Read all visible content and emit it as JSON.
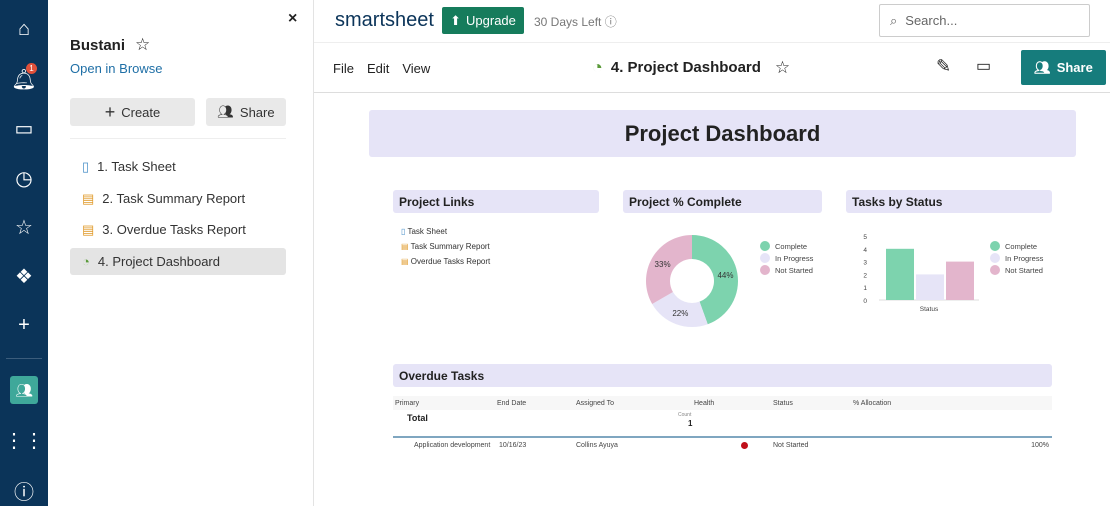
{
  "nav": {
    "notification_count": "1"
  },
  "panel": {
    "workspace": "Bustani",
    "open_in_browse": "Open in Browse",
    "create": "Create",
    "share": "Share",
    "items": [
      {
        "label": "1. Task Sheet",
        "icon": "sheet-icon"
      },
      {
        "label": "2. Task Summary Report",
        "icon": "report-icon"
      },
      {
        "label": "3. Overdue Tasks Report",
        "icon": "report-icon"
      },
      {
        "label": "4. Project Dashboard",
        "icon": "dashboard-icon"
      }
    ]
  },
  "topbar": {
    "logo": "smartsheet",
    "upgrade": "Upgrade",
    "trial": "30 Days Left",
    "search_placeholder": "Search..."
  },
  "toolbar": {
    "menu": [
      "File",
      "Edit",
      "View"
    ],
    "title": "4. Project Dashboard",
    "share": "Share"
  },
  "dashboard": {
    "title": "Project Dashboard",
    "links": {
      "title": "Project Links",
      "items": [
        "Task Sheet",
        "Task Summary Report",
        "Overdue Tasks Report"
      ]
    },
    "overdue": {
      "title": "Overdue Tasks",
      "columns": [
        "Primary",
        "End Date",
        "Assigned To",
        "Health",
        "Status",
        "% Allocation"
      ],
      "total_label": "Total",
      "count_label": "Count",
      "count": "1",
      "rows": [
        {
          "primary": "Application development",
          "end_date": "10/16/23",
          "assigned": "Collins Ayuya",
          "health": "red",
          "status": "Not Started",
          "allocation": "100%"
        }
      ]
    }
  },
  "chart_data": [
    {
      "type": "pie",
      "title": "Project % Complete",
      "donut": true,
      "categories": [
        "Complete",
        "In Progress",
        "Not Started"
      ],
      "values": [
        44,
        22,
        33
      ],
      "labels": [
        "44%",
        "22%",
        "33%"
      ],
      "colors": [
        "#7dd3ae",
        "#e6e4f7",
        "#e3b5cc"
      ],
      "legend": "right"
    },
    {
      "type": "bar",
      "title": "Tasks by Status",
      "categories": [
        "Complete",
        "In Progress",
        "Not Started"
      ],
      "values": [
        4,
        2,
        3
      ],
      "xlabel": "Status",
      "yticks": [
        "0",
        "1",
        "2",
        "3",
        "4",
        "5"
      ],
      "ylim": [
        0,
        5
      ],
      "colors": [
        "#7dd3ae",
        "#e6e4f7",
        "#e3b5cc"
      ],
      "legend": "right"
    }
  ]
}
